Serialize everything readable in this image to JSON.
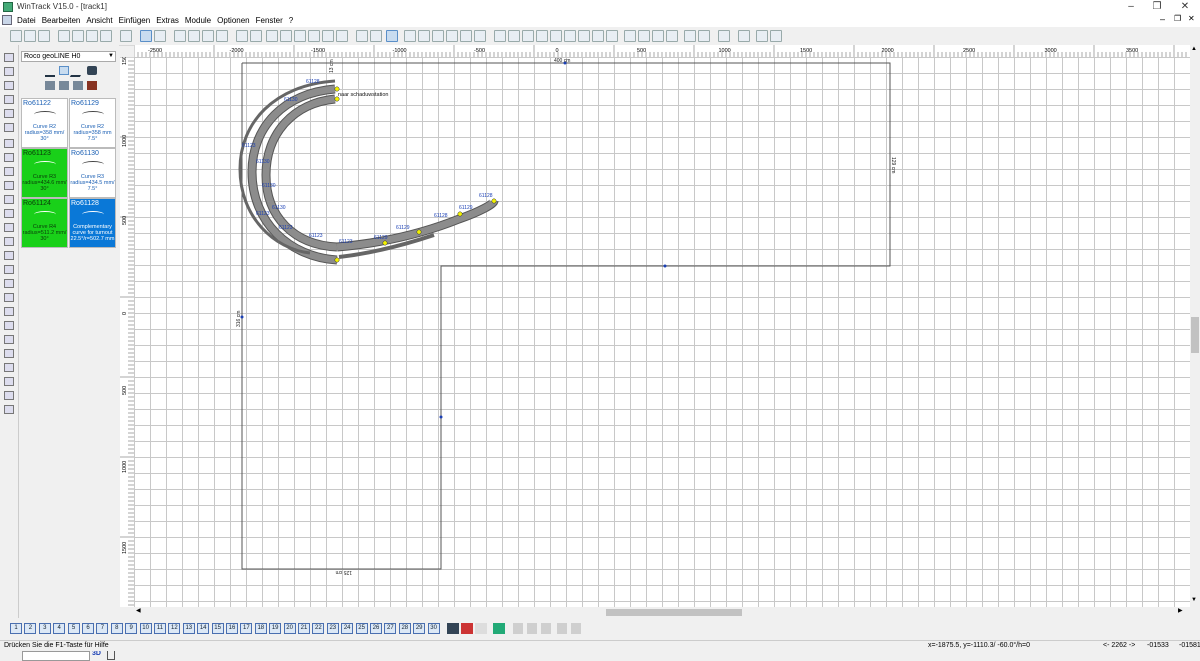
{
  "window": {
    "title": "WinTrack  V15.0 - [track1]"
  },
  "menu": [
    "Datei",
    "Bearbeiten",
    "Ansicht",
    "Einfügen",
    "Extras",
    "Module",
    "Optionen",
    "Fenster",
    "?"
  ],
  "library": {
    "selected": "Roco geoLINE H0",
    "tiles": [
      {
        "code": "Ro61122",
        "desc": [
          "Curve R2",
          "radius=358 mm/",
          "30°"
        ],
        "style": "white"
      },
      {
        "code": "Ro61129",
        "desc": [
          "Curve R2",
          "radius=358 mm",
          "7.5°"
        ],
        "style": "white"
      },
      {
        "code": "Ro61123",
        "desc": [
          "Curve R3",
          "radius=434.6 mm/",
          "30°"
        ],
        "style": "green"
      },
      {
        "code": "Ro61130",
        "desc": [
          "Curve R3",
          "radius=434.5 mm/",
          "7.5°"
        ],
        "style": "white"
      },
      {
        "code": "Ro61124",
        "desc": [
          "Curve R4",
          "radius=511.2 mm/",
          "30°"
        ],
        "style": "green"
      },
      {
        "code": "Ro61128",
        "desc": [
          "Complementary",
          "curve for turnout",
          "22.5°/r=502.7 mm"
        ],
        "style": "blue"
      }
    ],
    "button_3d": "3D"
  },
  "ruler": {
    "h_labels": [
      "-2500",
      "-2000",
      "-1500",
      "-1000",
      "-500",
      "0",
      "500",
      "1000",
      "1500",
      "2000",
      "2500",
      "3000",
      "3500"
    ],
    "v_labels": [
      "1500",
      "1000",
      "500",
      "0",
      "500",
      "1000",
      "1500"
    ]
  },
  "drawing": {
    "dimensions": {
      "top": "400 cm",
      "right": "129 cm",
      "left": "316 cm",
      "bottom": "125 cm",
      "short": "13 cm"
    },
    "annotation": "naar schaduwstation",
    "track_labels": [
      "61128",
      "61130",
      "61123",
      "61130",
      "61130",
      "61130",
      "61123",
      "61123",
      "61123",
      "61123",
      "61129",
      "61129",
      "61128",
      "61129",
      "61128"
    ]
  },
  "page_tabs": [
    "1",
    "2",
    "3",
    "4",
    "5",
    "6",
    "7",
    "8",
    "9",
    "10",
    "11",
    "12",
    "13",
    "14",
    "15",
    "16",
    "17",
    "18",
    "19",
    "20",
    "21",
    "22",
    "23",
    "24",
    "25",
    "26",
    "27",
    "28",
    "29",
    "30"
  ],
  "status": {
    "help": "Drücken Sie die  F1-Taste für Hilfe",
    "coords": "x=-1875.5, y=-1110.3/ -60.0°/h=0",
    "zoom": "<- 2262 ->",
    "v1": "-01533",
    "v2": "-01581"
  },
  "colors": {
    "tile_green": "#19d019",
    "tile_blue": "#0a78d7",
    "track_fill": "#8c8c8c",
    "endpoint": "#f2f200"
  }
}
